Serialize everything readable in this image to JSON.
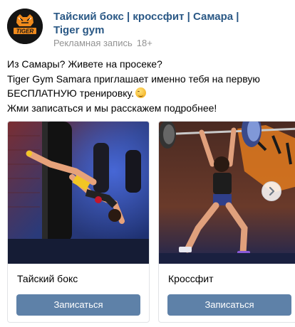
{
  "header": {
    "avatar_name": "tiger-logo",
    "avatar_text": "TIGER",
    "author_name": "Тайский бокс | кроссфит | Самара | Tiger gym",
    "ad_label": "Рекламная запись",
    "age_rating": "18+"
  },
  "post_text": {
    "line1": "Из Самары? Живете на просеке?",
    "line2": "Tiger Gym Samara приглашает именно тебя на первую",
    "line3": "БЕСПЛАТНУЮ тренировку.",
    "line3_emoji": "winking-face-icon",
    "line4": "Жми записаться и мы расскажем подробнее!"
  },
  "carousel": {
    "cards": [
      {
        "title": "Тайский бокс",
        "button_label": "Записаться",
        "photo": "muay-thai-heavy-bag-photo"
      },
      {
        "title": "Кроссфит",
        "button_label": "Записаться",
        "photo": "crossfit-barbell-lunge-photo"
      }
    ],
    "next_icon": "chevron-right-icon"
  },
  "colors": {
    "link": "#2a5885",
    "meta": "#939393",
    "button": "#5e81a8",
    "button_text": "#ffffff"
  }
}
